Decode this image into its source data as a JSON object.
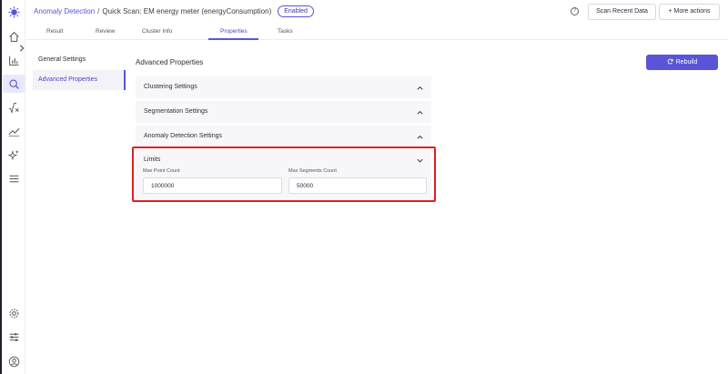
{
  "header": {
    "crumb_root": "Anomaly Detection",
    "separator": "/",
    "crumb_current": "Quick Scan: EM energy meter (energyConsumption)",
    "status_badge": "Enabled",
    "help_glyph": "?",
    "scan_button": "Scan Recent Data",
    "more_actions_button": "More actions",
    "more_actions_prefix": "+"
  },
  "tabs": [
    {
      "label": "Result"
    },
    {
      "label": "Review"
    },
    {
      "label": "Cluster Info"
    },
    {
      "label": "Properties",
      "active": true
    },
    {
      "label": "Tasks"
    }
  ],
  "settings_nav": [
    {
      "label": "General Settings"
    },
    {
      "label": "Advanced Properties",
      "active": true
    }
  ],
  "main": {
    "title": "Advanced Properties",
    "rebuild_button": "Rebuild",
    "sections": [
      {
        "label": "Clustering Settings",
        "expanded": false
      },
      {
        "label": "Segmentation Settings",
        "expanded": false
      },
      {
        "label": "Anomaly Detection Settings",
        "expanded": false
      }
    ],
    "limits": {
      "label": "Limits",
      "expanded": true,
      "max_point_label": "Max Point Count",
      "max_point_value": "1000000",
      "max_segments_label": "Max Segments Count",
      "max_segments_value": "50000"
    }
  },
  "rail_icons": [
    "app-logo-icon",
    "home-icon",
    "bar-chart-icon",
    "search-icon",
    "sqrt-icon",
    "trend-icon",
    "sparkle-icon",
    "menu-icon",
    "settings-icon",
    "sliders-icon",
    "user-icon"
  ],
  "colors": {
    "accent": "#5a55d6",
    "highlight": "#e02020"
  }
}
